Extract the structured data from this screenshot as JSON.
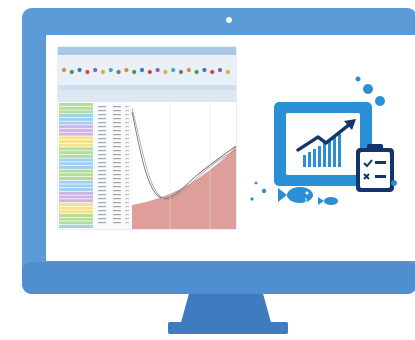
{
  "colors": {
    "monitor_body": "#5b9ad6",
    "monitor_edge": "#4a86c2",
    "stand": "#3e7bbf",
    "screen": "#ffffff",
    "icon_blue": "#2b8fd6",
    "icon_navy": "#13366a",
    "app_header": "#a9c7e6",
    "chart_fill": "#d88e8a"
  },
  "icons": [
    "camera-dot",
    "analytics-monitor-icon",
    "trend-arrow-icon",
    "checklist-icon",
    "fish-icon",
    "bubbles-icon"
  ],
  "app_window": {
    "title_bar": "",
    "ribbon_tabs": [],
    "grid_rows": 34
  }
}
